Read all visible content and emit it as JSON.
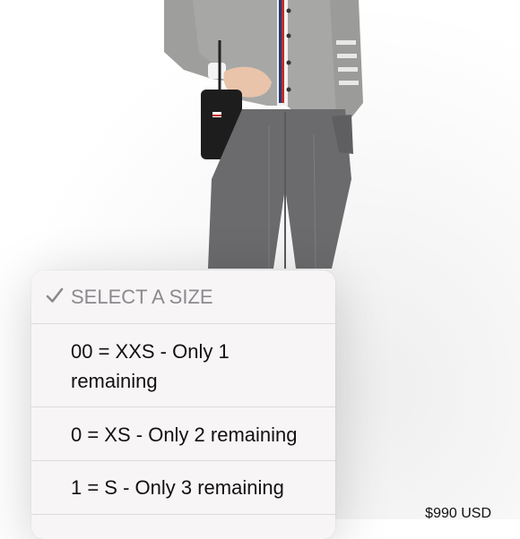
{
  "size_picker": {
    "options": [
      {
        "label": "SELECT A SIZE",
        "selected": true
      },
      {
        "label": "00 = XXS - Only 1 remaining",
        "selected": false
      },
      {
        "label": "0 = XS - Only 2 remaining",
        "selected": false
      },
      {
        "label": "1 = S - Only 3 remaining",
        "selected": false
      }
    ],
    "check_icon": "checkmark-icon"
  },
  "product": {
    "price": "$990 USD"
  },
  "colors": {
    "popup_bg": "#f8f5f6",
    "selected_text": "#8a8a8e",
    "text": "#111111"
  }
}
